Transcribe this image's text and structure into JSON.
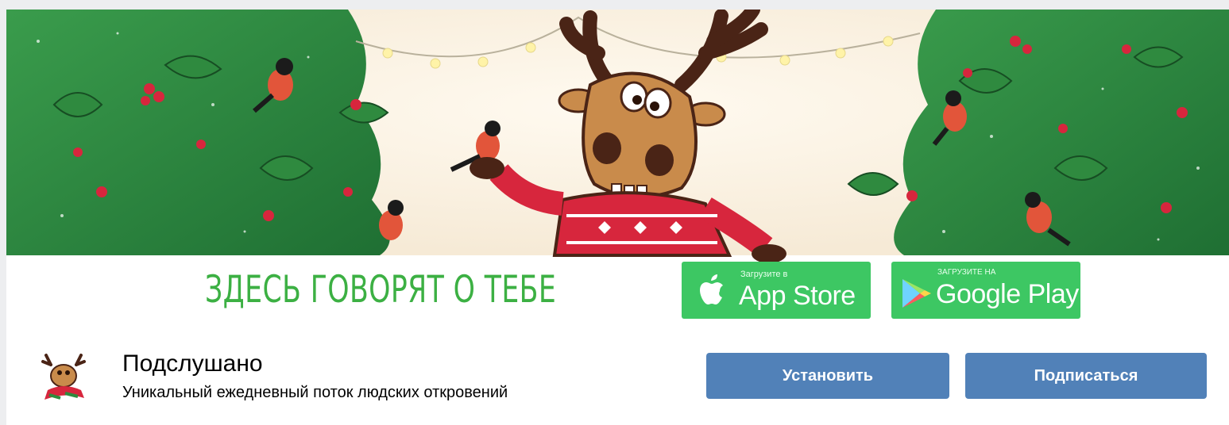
{
  "cover": {
    "slogan": "ЗДЕСЬ ГОВОРЯТ О ТЕБЕ",
    "app_store": {
      "small": "Загрузите в",
      "big": "App Store",
      "icon": "apple-icon"
    },
    "google_play": {
      "small": "ЗАГРУЗИТЕ НА",
      "big": "Google Play",
      "icon": "google-play-icon"
    },
    "colors": {
      "foliage": "#2e8b3e",
      "slogan": "#3cb043",
      "badge": "#3dc763",
      "berry": "#d7263d"
    }
  },
  "group": {
    "name": "Подслушано",
    "status": "Уникальный ежедневный поток людских откровений"
  },
  "actions": {
    "install_label": "Установить",
    "subscribe_label": "Подписаться",
    "button_color": "#5181b8"
  }
}
